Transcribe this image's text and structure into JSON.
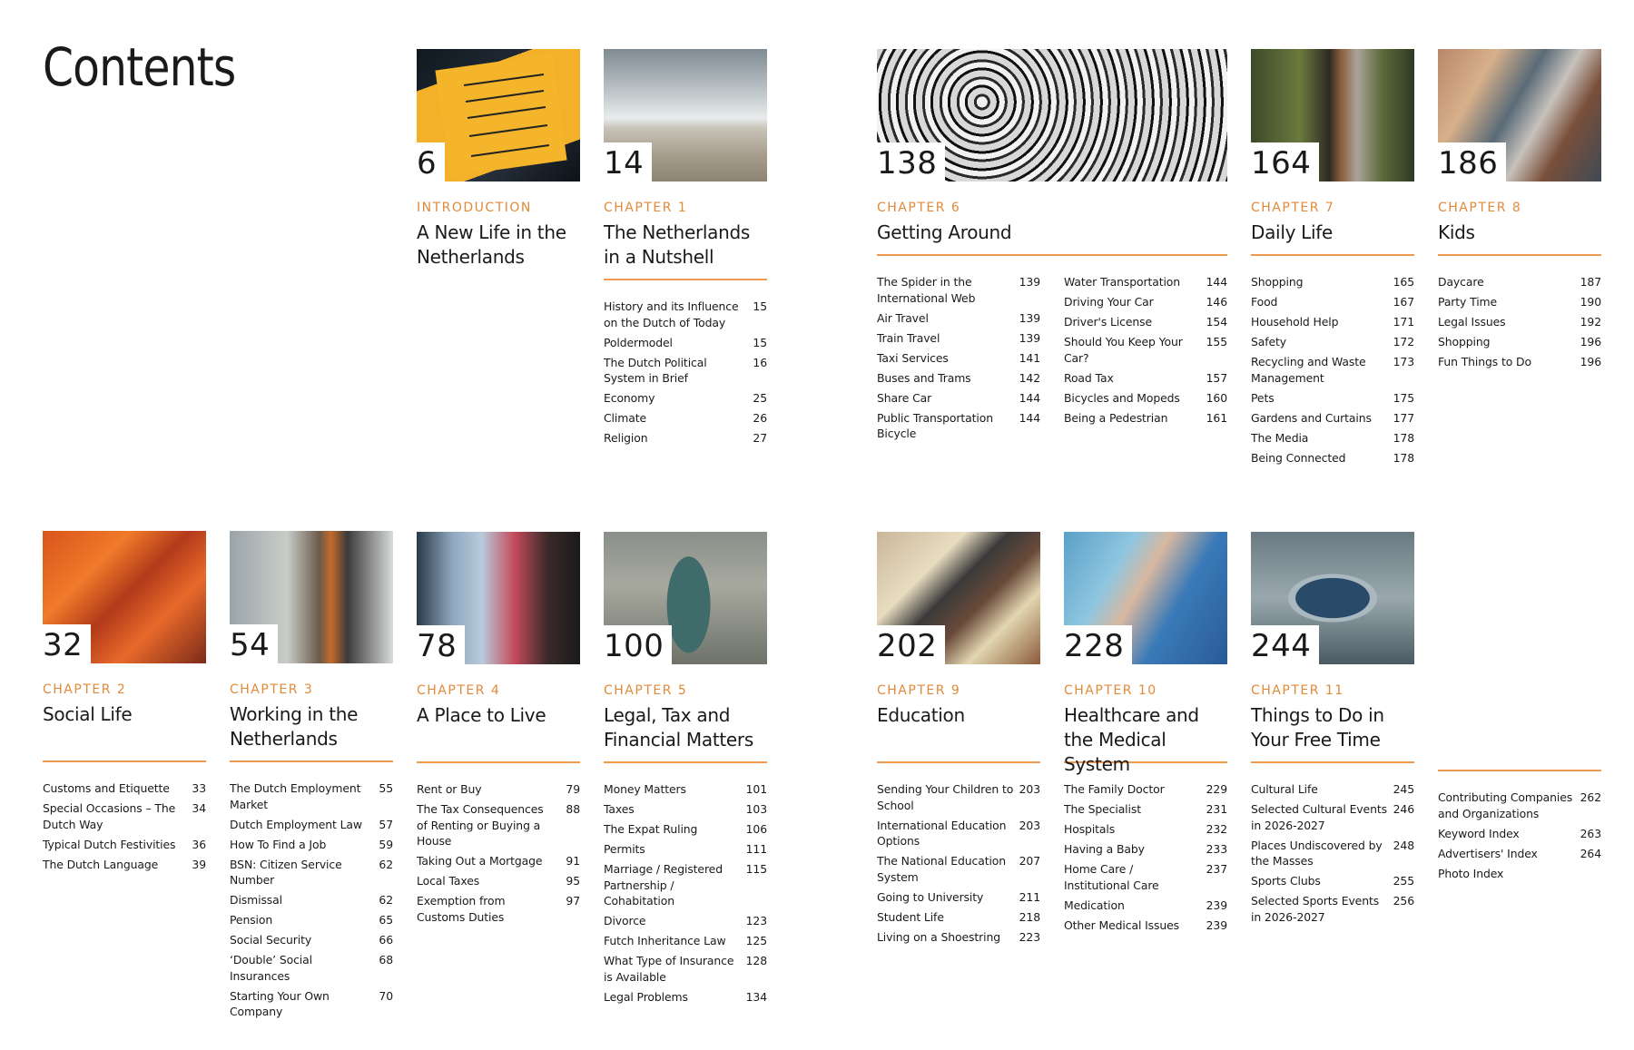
{
  "page_title": "Contents",
  "colors": {
    "accent": "#e08a3a",
    "rule": "#ef9a4e",
    "text": "#1a1a1a"
  },
  "chapters": {
    "intro": {
      "page": "6",
      "kicker": "INTRODUCTION",
      "title": "A New Life in the Netherlands",
      "image": "airport-sign-photo",
      "items": []
    },
    "ch1": {
      "page": "14",
      "kicker": "CHAPTER 1",
      "title": "The Netherlands in a Nutshell",
      "image": "beach-photo",
      "items": [
        {
          "label": "History and its Influence on the Dutch of Today",
          "page": "15"
        },
        {
          "label": "Poldermodel",
          "page": "15"
        },
        {
          "label": "The Dutch Political System in Brief",
          "page": "16"
        },
        {
          "label": "Economy",
          "page": "25"
        },
        {
          "label": "Climate",
          "page": "26"
        },
        {
          "label": "Religion",
          "page": "27"
        }
      ]
    },
    "ch6": {
      "page": "138",
      "kicker": "CHAPTER 6",
      "title": "Getting Around",
      "image": "snowy-bicycles-photo",
      "items_col1": [
        {
          "label": "The Spider in the International Web",
          "page": "139"
        },
        {
          "label": "Air Travel",
          "page": "139"
        },
        {
          "label": "Train Travel",
          "page": "139"
        },
        {
          "label": "Taxi Services",
          "page": "141"
        },
        {
          "label": "Buses and Trams",
          "page": "142"
        },
        {
          "label": "Share Car",
          "page": "144"
        },
        {
          "label": "Public Transportation Bicycle",
          "page": "144"
        }
      ],
      "items_col2": [
        {
          "label": "Water Transportation",
          "page": "144"
        },
        {
          "label": "Driving Your Car",
          "page": "146"
        },
        {
          "label": "Driver's License",
          "page": "154"
        },
        {
          "label": "Should You Keep Your Car?",
          "page": "155"
        },
        {
          "label": "Road Tax",
          "page": "157"
        },
        {
          "label": "Bicycles and Mopeds",
          "page": "160"
        },
        {
          "label": "Being a Pedestrian",
          "page": "161"
        }
      ]
    },
    "ch7": {
      "page": "164",
      "kicker": "CHAPTER 7",
      "title": "Daily Life",
      "image": "canal-boat-photo",
      "items": [
        {
          "label": "Shopping",
          "page": "165"
        },
        {
          "label": "Food",
          "page": "167"
        },
        {
          "label": "Household Help",
          "page": "171"
        },
        {
          "label": "Safety",
          "page": "172"
        },
        {
          "label": "Recycling and Waste Management",
          "page": "173"
        },
        {
          "label": "Pets",
          "page": "175"
        },
        {
          "label": "Gardens and Curtains",
          "page": "177"
        },
        {
          "label": "The Media",
          "page": "178"
        },
        {
          "label": "Being Connected",
          "page": "178"
        }
      ]
    },
    "ch8": {
      "page": "186",
      "kicker": "CHAPTER 8",
      "title": "Kids",
      "image": "family-cycling-photo",
      "items": [
        {
          "label": "Daycare",
          "page": "187"
        },
        {
          "label": "Party Time",
          "page": "190"
        },
        {
          "label": "Legal Issues",
          "page": "192"
        },
        {
          "label": "Shopping",
          "page": "196"
        },
        {
          "label": "Fun Things to Do",
          "page": "196"
        }
      ]
    },
    "ch2": {
      "page": "32",
      "kicker": "CHAPTER 2",
      "title": "Social Life",
      "image": "orange-fans-photo",
      "items": [
        {
          "label": "Customs and Etiquette",
          "page": "33"
        },
        {
          "label": "Special Occasions – The Dutch Way",
          "page": "34"
        },
        {
          "label": "Typical Dutch Festivities",
          "page": "36"
        },
        {
          "label": "The Dutch Language",
          "page": "39"
        }
      ]
    },
    "ch3": {
      "page": "54",
      "kicker": "CHAPTER 3",
      "title": "Working in the Netherlands",
      "image": "office-worker-photo",
      "items": [
        {
          "label": "The Dutch Employment Market",
          "page": "55"
        },
        {
          "label": "Dutch Employment Law",
          "page": "57"
        },
        {
          "label": "How To Find a Job",
          "page": "59"
        },
        {
          "label": "BSN: Citizen Service Number",
          "page": "62"
        },
        {
          "label": "Dismissal",
          "page": "62"
        },
        {
          "label": "Pension",
          "page": "65"
        },
        {
          "label": "Social Security",
          "page": "66"
        },
        {
          "label": "‘Double’ Social Insurances",
          "page": "68"
        },
        {
          "label": "Starting Your Own Company",
          "page": "70"
        }
      ]
    },
    "ch4": {
      "page": "78",
      "kicker": "CHAPTER 4",
      "title": "A Place to Live",
      "image": "apartment-building-photo",
      "items": [
        {
          "label": "Rent or Buy",
          "page": "79"
        },
        {
          "label": "The Tax Consequences of Renting or Buying a House",
          "page": "88"
        },
        {
          "label": "Taking Out a Mortgage",
          "page": "91"
        },
        {
          "label": "Local Taxes",
          "page": "95"
        },
        {
          "label": "Exemption from Customs Duties",
          "page": "97"
        }
      ]
    },
    "ch5": {
      "page": "100",
      "kicker": "CHAPTER 5",
      "title": "Legal, Tax and Financial Matters",
      "image": "tower-aerial-photo",
      "items": [
        {
          "label": "Money Matters",
          "page": "101"
        },
        {
          "label": "Taxes",
          "page": "103"
        },
        {
          "label": "The Expat Ruling",
          "page": "106"
        },
        {
          "label": "Permits",
          "page": "111"
        },
        {
          "label": "Marriage / Registered Partnership / Cohabitation",
          "page": "115"
        },
        {
          "label": "Divorce",
          "page": "123"
        },
        {
          "label": "Futch Inheritance Law",
          "page": "125"
        },
        {
          "label": "What Type of Insurance is Available",
          "page": "128"
        },
        {
          "label": "Legal Problems",
          "page": "134"
        }
      ]
    },
    "ch9": {
      "page": "202",
      "kicker": "CHAPTER 9",
      "title": "Education",
      "image": "laptop-student-photo",
      "items": [
        {
          "label": "Sending Your Children to School",
          "page": "203"
        },
        {
          "label": "International Education Options",
          "page": "203"
        },
        {
          "label": "The National Education System",
          "page": "207"
        },
        {
          "label": "Going to University",
          "page": "211"
        },
        {
          "label": "Student Life",
          "page": "218"
        },
        {
          "label": "Living on a Shoestring",
          "page": "223"
        }
      ]
    },
    "ch10": {
      "page": "228",
      "kicker": "CHAPTER 10",
      "title": "Healthcare and the Medical System",
      "image": "medical-worker-photo",
      "items": [
        {
          "label": "The Family Doctor",
          "page": "229"
        },
        {
          "label": "The Specialist",
          "page": "231"
        },
        {
          "label": "Hospitals",
          "page": "232"
        },
        {
          "label": "Having a Baby",
          "page": "233"
        },
        {
          "label": "Home Care / Institutional Care",
          "page": "237"
        },
        {
          "label": "Medication",
          "page": "239"
        },
        {
          "label": "Other Medical Issues",
          "page": "239"
        }
      ]
    },
    "ch11": {
      "page": "244",
      "kicker": "CHAPTER 11",
      "title": "Things to Do in Your Free Time",
      "image": "modern-building-photo",
      "items": [
        {
          "label": "Cultural Life",
          "page": "245"
        },
        {
          "label": "Selected Cultural Events in 2026-2027",
          "page": "246"
        },
        {
          "label": "Places Undiscovered by the Masses",
          "page": "248"
        },
        {
          "label": "Sports Clubs",
          "page": "255"
        },
        {
          "label": "Selected Sports Events in 2026-2027",
          "page": "256"
        }
      ]
    },
    "appendix": {
      "items": [
        {
          "label": "Contributing Companies and Organizations",
          "page": "262"
        },
        {
          "label": "Keyword Index",
          "page": "263"
        },
        {
          "label": "Advertisers' Index",
          "page": "264"
        },
        {
          "label": "Photo Index",
          "page": ""
        }
      ]
    }
  }
}
